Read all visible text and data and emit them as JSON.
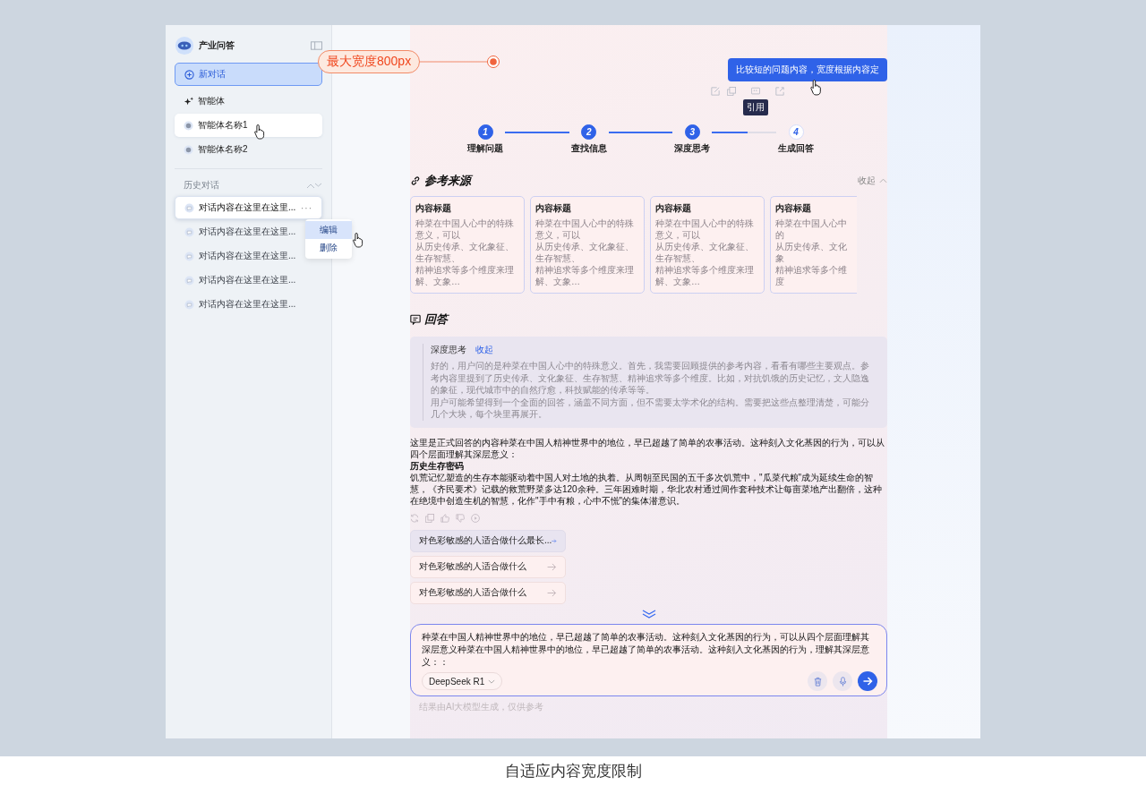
{
  "annotation": {
    "label": "最大宽度800px"
  },
  "sidebar": {
    "app_name": "产业问答",
    "new_chat": {
      "label": "新对话",
      "selected": true
    },
    "agents_label": "智能体",
    "agents": [
      {
        "name": "智能体名称1",
        "hovered": true
      },
      {
        "name": "智能体名称2",
        "hovered": false
      }
    ],
    "history_label": "历史对话",
    "history": [
      {
        "title": "对话内容在这里在这里...",
        "hovered": true,
        "more": "···"
      },
      {
        "title": "对话内容在这里在这里...",
        "hovered": false
      },
      {
        "title": "对话内容在这里在这里...",
        "hovered": false
      },
      {
        "title": "对话内容在这里在这里...",
        "hovered": false
      },
      {
        "title": "对话内容在这里在这里...",
        "hovered": false
      }
    ],
    "context_menu": [
      {
        "label": "编辑",
        "hovered": true
      },
      {
        "label": "删除",
        "hovered": false
      }
    ]
  },
  "user_message": {
    "text": "比较短的问题内容，宽度根据内容定",
    "tooltip": "引用"
  },
  "steps": [
    {
      "number": "1",
      "label": "理解问题",
      "done": true
    },
    {
      "number": "2",
      "label": "查找信息",
      "done": true
    },
    {
      "number": "3",
      "label": "深度思考",
      "done": true
    },
    {
      "number": "4",
      "label": "生成回答",
      "done": false
    }
  ],
  "connectors": [
    {
      "level": 1
    },
    {
      "level": 1
    },
    {
      "level": 0.55
    }
  ],
  "sources": {
    "title": "参考来源",
    "collapse": "收起",
    "cards": [
      {
        "title": "内容标题",
        "lines": [
          "种菜在中国人心中的特殊意义，可以",
          "从历史传承、文化象征、生存智慧、",
          "精神追求等多个维度来理解、文象…"
        ]
      },
      {
        "title": "内容标题",
        "lines": [
          "种菜在中国人心中的特殊意义，可以",
          "从历史传承、文化象征、生存智慧、",
          "精神追求等多个维度来理解、文象…"
        ]
      },
      {
        "title": "内容标题",
        "lines": [
          "种菜在中国人心中的特殊意义，可以",
          "从历史传承、文化象征、生存智慧、",
          "精神追求等多个维度来理解、文象…"
        ]
      },
      {
        "title": "内容标题",
        "lines": [
          "种菜在中国人心中的",
          "从历史传承、文化象",
          "精神追求等多个维度"
        ]
      }
    ]
  },
  "answer": {
    "title": "回答",
    "thinking": {
      "title": "深度思考",
      "collapse": "收起",
      "paragraphs": [
        "好的，用户问的是种菜在中国人心中的特殊意义。首先，我需要回顾提供的参考内容，看看有哪些主要观点。参考内容里提到了历史传承、文化象征、生存智慧、精神追求等多个维度。比如，对抗饥饿的历史记忆，文人隐逸的象征，现代城市中的自然疗愈，科技赋能的传承等等。",
        "用户可能希望得到一个全面的回答，涵盖不同方面，但不需要太学术化的结构。需要把这些点整理清楚，可能分几个大块，每个块里再展开。"
      ]
    },
    "blocks": [
      {
        "kind": "paragraph",
        "text": "这里是正式回答的内容种菜在中国人精神世界中的地位，早已超越了简单的农事活动。这种刻入文化基因的行为，可以从四个层面理解其深层意义："
      },
      {
        "kind": "heading",
        "text": "历史生存密码"
      },
      {
        "kind": "paragraph",
        "text": "饥荒记忆塑造的生存本能驱动着中国人对土地的执着。从周朝至民国的五千多次饥荒中，\"瓜菜代粮\"成为延续生命的智慧，《齐民要术》记载的救荒野菜多达120余种。三年困难时期，华北农村通过间作套种技术让每亩菜地产出翻倍，这种在绝境中创造生机的智慧，化作\"手中有粮，心中不慌\"的集体潜意识。"
      }
    ],
    "suggestions": [
      {
        "text": "对色彩敏感的人适合做什么最长...",
        "hovered": true
      },
      {
        "text": "对色彩敏感的人适合做什么",
        "hovered": false
      },
      {
        "text": "对色彩敏感的人适合做什么",
        "hovered": false
      }
    ]
  },
  "input": {
    "value": "种菜在中国人精神世界中的地位，早已超越了简单的农事活动。这种刻入文化基因的行为，可以从四个层面理解其深层意义种菜在中国人精神世界中的地位，早已超越了简单的农事活动。这种刻入文化基因的行为，理解其深层意义：：",
    "model": "DeepSeek R1",
    "hint": "结果由AI大模型生成，仅供参考"
  },
  "caption": "自适应内容宽度限制"
}
